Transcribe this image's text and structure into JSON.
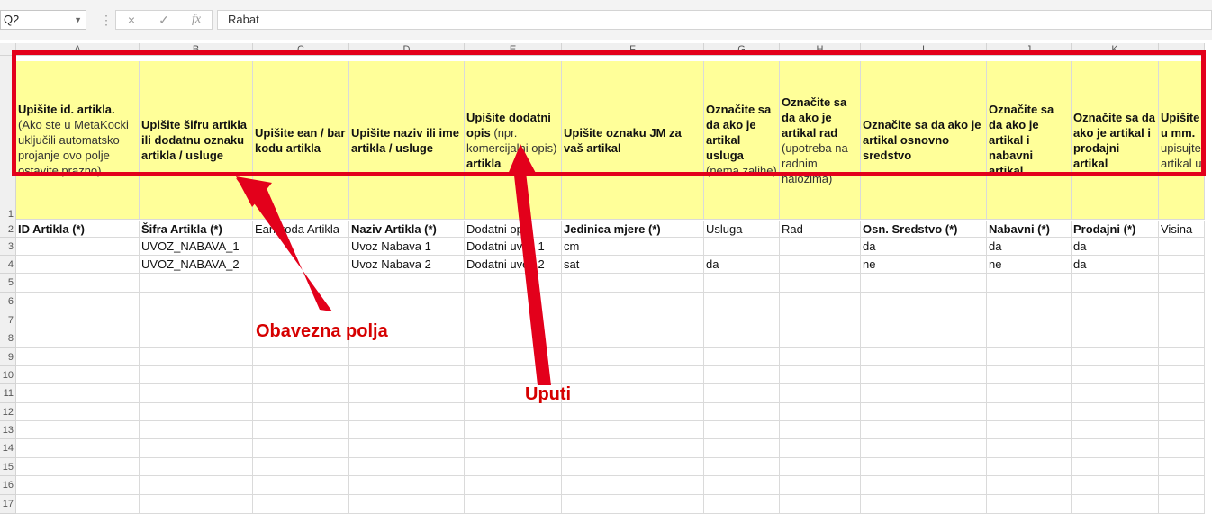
{
  "formula_bar": {
    "name_box": "Q2",
    "cancel_icon": "×",
    "enter_icon": "✓",
    "fx_icon": "fx",
    "formula": "Rabat"
  },
  "columns": [
    "A",
    "B",
    "C",
    "D",
    "E",
    "F",
    "G",
    "H",
    "I",
    "J",
    "K",
    ""
  ],
  "rows": [
    "1",
    "2",
    "3",
    "4",
    "5",
    "6",
    "7",
    "8",
    "9",
    "10",
    "11",
    "12",
    "13",
    "14",
    "15",
    "16",
    "17"
  ],
  "instructions": [
    {
      "bold": "Upišite id. artikla.",
      "note": "(Ako ste u MetaKocki uključili automatsko projanje ovo polje ostavite prazno)",
      "bold2": ""
    },
    {
      "bold": "Upišite šifru artikla ili dodatnu oznaku artikla / usluge",
      "note": "",
      "bold2": ""
    },
    {
      "bold": "Upišite ean / bar kodu artikla",
      "note": "",
      "bold2": ""
    },
    {
      "bold": "Upišite naziv ili ime artikla / usluge",
      "note": "",
      "bold2": ""
    },
    {
      "bold": "Upišite dodatni opis",
      "note": "(npr. komercijalni opis)",
      "bold2": "artikla"
    },
    {
      "bold": "Upišite oznaku JM za vaš artikal",
      "note": "",
      "bold2": ""
    },
    {
      "bold": "Označite sa da ako je artikal usluga",
      "note": "(nema zalihe)",
      "bold2": ""
    },
    {
      "bold": "Označite sa da ako je artikal rad",
      "note": "(upotreba na radnim nalozima)",
      "bold2": ""
    },
    {
      "bold": "Označite sa da ako je artikal osnovno sredstvo",
      "note": "",
      "bold2": ""
    },
    {
      "bold": "Označite sa da ako je artikal i nabavni artikal",
      "note": "",
      "bold2": ""
    },
    {
      "bold": "Označite sa da ako je artikal i prodajni artikal",
      "note": "",
      "bold2": ""
    },
    {
      "bold": "Upišite u mm.",
      "note": "upisujte artikal u",
      "bold2": ""
    }
  ],
  "field_headers": [
    "ID Artikla (*)",
    "Šifra Artikla  (*)",
    "Ean koda Artikla",
    "Naziv Artikla (*)",
    "Dodatni opis",
    "Jedinica mjere (*)",
    "Usluga",
    "Rad",
    "Osn. Sredstvo (*)",
    "Nabavni (*)",
    "Prodajni (*)",
    "Visina"
  ],
  "data_rows": [
    [
      "",
      "UVOZ_NABAVA_1",
      "",
      "Uvoz Nabava 1",
      "Dodatni uvoz 1",
      "cm",
      "",
      "",
      "da",
      "da",
      "da",
      ""
    ],
    [
      "",
      "UVOZ_NABAVA_2",
      "",
      "Uvoz Nabava 2",
      "Dodatni uvoz 2",
      "sat",
      "da",
      "",
      "ne",
      "ne",
      "da",
      ""
    ]
  ],
  "annotations": {
    "required": "Obavezna polja",
    "instructions": "Uputi"
  },
  "colors": {
    "highlight_yellow": "#ffff99",
    "annotation_red": "#e3001b"
  }
}
